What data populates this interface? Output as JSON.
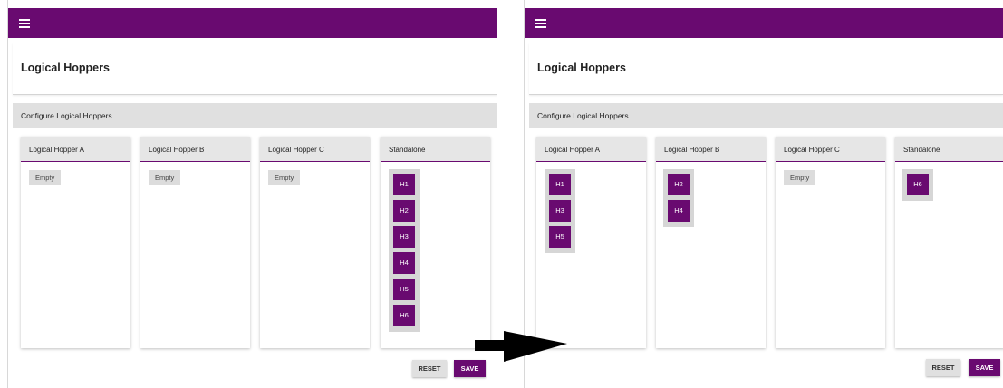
{
  "screens": [
    {
      "page_title": "Logical Hoppers",
      "section_title": "Configure Logical Hoppers",
      "columns": [
        {
          "label": "Logical Hopper A",
          "empty_label": "Empty",
          "items": []
        },
        {
          "label": "Logical Hopper B",
          "empty_label": "Empty",
          "items": []
        },
        {
          "label": "Logical Hopper C",
          "empty_label": "Empty",
          "items": []
        },
        {
          "label": "Standalone",
          "items": [
            "H1",
            "H2",
            "H3",
            "H4",
            "H5",
            "H6"
          ]
        }
      ],
      "reset_label": "RESET",
      "save_label": "SAVE"
    },
    {
      "page_title": "Logical Hoppers",
      "section_title": "Configure Logical Hoppers",
      "columns": [
        {
          "label": "Logical Hopper A",
          "items": [
            "H1",
            "H3",
            "H5"
          ]
        },
        {
          "label": "Logical Hopper B",
          "items": [
            "H2",
            "H4"
          ]
        },
        {
          "label": "Logical Hopper C",
          "empty_label": "Empty",
          "items": []
        },
        {
          "label": "Standalone",
          "items": [
            "H6"
          ]
        }
      ],
      "reset_label": "RESET",
      "save_label": "SAVE"
    }
  ],
  "icons": {
    "menu": "hamburger-menu-icon",
    "transition": "right-arrow-icon"
  },
  "colors": {
    "primary": "#690a70",
    "header_gray": "#e0e0e0",
    "chip_gray": "#dcdcdc"
  }
}
